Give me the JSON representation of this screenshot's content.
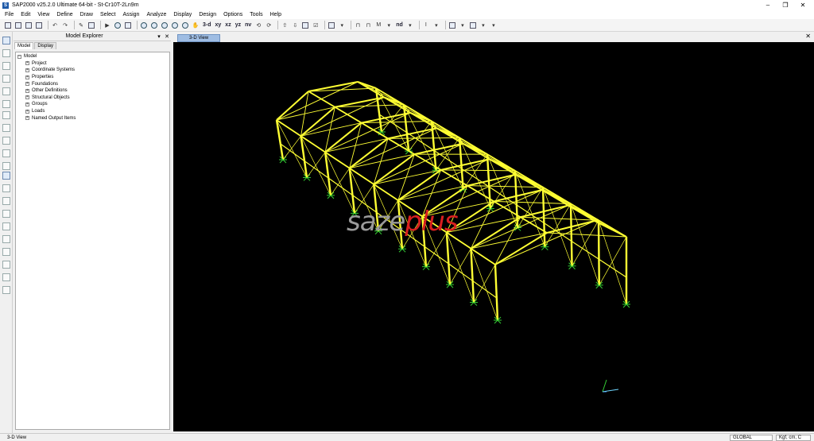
{
  "window": {
    "title": "SAP2000 v25.2.0 Ultimate 64-bit - St-Cr10T-2Ln9m",
    "minimize": "–",
    "restore": "❐",
    "close": "✕"
  },
  "menu": [
    "File",
    "Edit",
    "View",
    "Define",
    "Draw",
    "Select",
    "Assign",
    "Analyze",
    "Display",
    "Design",
    "Options",
    "Tools",
    "Help"
  ],
  "toolbar": {
    "view_3d": "3-d",
    "view_xy": "xy",
    "view_xz": "xz",
    "view_yz": "yz",
    "view_nv": "nv",
    "nd": "nd"
  },
  "explorer": {
    "title": "Model Explorer",
    "pin": "▾",
    "close": "✕",
    "tabs": [
      "Model",
      "Display"
    ],
    "root": "Model",
    "items": [
      "Project",
      "Coordinate Systems",
      "Properties",
      "Foundations",
      "Other Definitions",
      "Structural Objects",
      "Groups",
      "Loads",
      "Named Output Items"
    ]
  },
  "view": {
    "tab_label": "3-D View",
    "close": "✕",
    "frame_color": "#ffff33",
    "support_color": "#33cc33",
    "watermark_part1": "saze",
    "watermark_part2": "plus"
  },
  "status": {
    "left": "3-D View",
    "coord_system": "GLOBAL",
    "units": "Kgf, cm, C"
  }
}
